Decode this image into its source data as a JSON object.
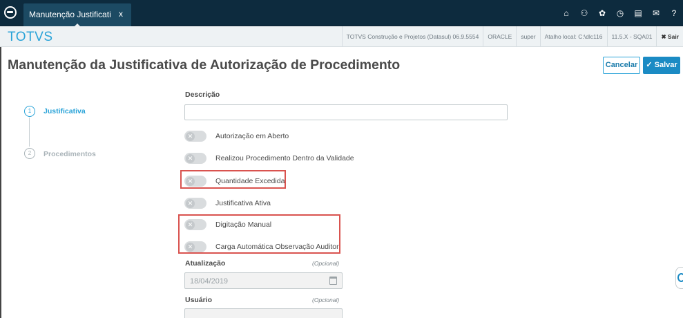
{
  "topbar": {
    "tab_title": "Manutenção Justificati",
    "tab_close": "x",
    "icons": [
      "home-icon",
      "sitemap-icon",
      "gear-icon",
      "clock-icon",
      "document-icon",
      "mail-icon",
      "help-icon"
    ],
    "icon_glyphs": [
      "⌂",
      "⚇",
      "✿",
      "◷",
      "▤",
      "✉",
      "?"
    ]
  },
  "subbar": {
    "brand": "TOTVS",
    "company": "TOTVS Construção e Projetos (Datasul) 06.9.5554",
    "db": "ORACLE",
    "user": "super",
    "shortcut": "Atalho local: C:\\dlc116",
    "version": "11.5.X - SQA01",
    "exit": "✖ Sair"
  },
  "page": {
    "title": "Manutenção da Justificativa de Autorização de Procedimento",
    "cancel_label": "Cancelar",
    "save_label": "✓ Salvar"
  },
  "stepper": {
    "steps": [
      {
        "number": "1",
        "label": "Justificativa",
        "active": true
      },
      {
        "number": "2",
        "label": "Procedimentos",
        "active": false
      }
    ]
  },
  "form": {
    "description_label": "Descrição",
    "description_value": "",
    "toggles": [
      {
        "label": "Autorização em Aberto",
        "on": false
      },
      {
        "label": "Realizou Procedimento Dentro da Validade",
        "on": false
      },
      {
        "label": "Quantidade Excedida",
        "on": false
      },
      {
        "label": "Justificativa Ativa",
        "on": false
      },
      {
        "label": "Digitação Manual",
        "on": false
      },
      {
        "label": "Carga Automática Observação Auditor",
        "on": false
      }
    ],
    "toggle_off_glyph": "✕",
    "update_label": "Atualização",
    "update_optional": "(Opcional)",
    "update_value": "18/04/2019",
    "user_label": "Usuário",
    "user_optional": "(Opcional)",
    "user_value": ""
  },
  "colors": {
    "topbar": "#0d2b3e",
    "brand": "#29a3d8",
    "primary": "#1b8bc4",
    "highlight": "#d9534f"
  }
}
